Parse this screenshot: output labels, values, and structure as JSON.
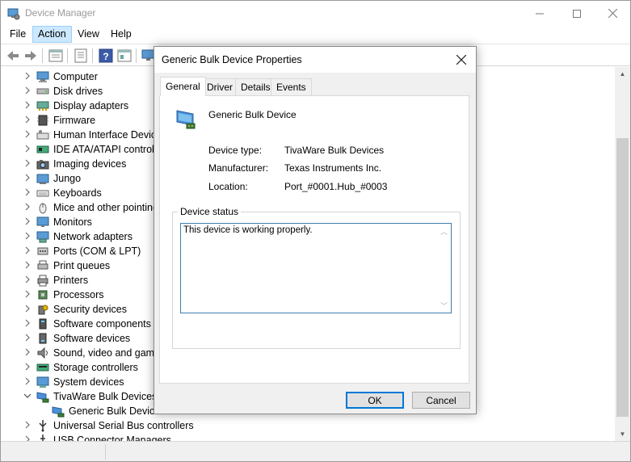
{
  "app": {
    "title": "Device Manager",
    "icon": "device-manager-icon",
    "window_controls": {
      "minimize": "—",
      "maximize": "☐",
      "close": "✕"
    }
  },
  "menu": [
    "File",
    "Action",
    "View",
    "Help"
  ],
  "toolbar_icons": [
    "back-arrow-icon",
    "forward-arrow-icon",
    "properties-grid-icon",
    "show-hide-tree-icon",
    "help-icon",
    "update-driver-icon",
    "monitor-icon"
  ],
  "tree": {
    "items": [
      {
        "label": "Computer",
        "icon": "computer-icon",
        "expanded": false
      },
      {
        "label": "Disk drives",
        "icon": "disk-drive-icon",
        "expanded": false
      },
      {
        "label": "Display adapters",
        "icon": "display-adapter-icon",
        "expanded": false
      },
      {
        "label": "Firmware",
        "icon": "firmware-icon",
        "expanded": false
      },
      {
        "label": "Human Interface Devices",
        "icon": "hid-icon",
        "expanded": false
      },
      {
        "label": "IDE ATA/ATAPI controllers",
        "icon": "ide-controller-icon",
        "expanded": false
      },
      {
        "label": "Imaging devices",
        "icon": "camera-icon",
        "expanded": false
      },
      {
        "label": "Jungo",
        "icon": "jungo-icon",
        "expanded": false
      },
      {
        "label": "Keyboards",
        "icon": "keyboard-icon",
        "expanded": false
      },
      {
        "label": "Mice and other pointing devices",
        "icon": "mouse-icon",
        "expanded": false
      },
      {
        "label": "Monitors",
        "icon": "monitor-icon",
        "expanded": false
      },
      {
        "label": "Network adapters",
        "icon": "network-adapter-icon",
        "expanded": false
      },
      {
        "label": "Ports (COM & LPT)",
        "icon": "port-icon",
        "expanded": false
      },
      {
        "label": "Print queues",
        "icon": "print-queue-icon",
        "expanded": false
      },
      {
        "label": "Printers",
        "icon": "printer-icon",
        "expanded": false
      },
      {
        "label": "Processors",
        "icon": "processor-icon",
        "expanded": false
      },
      {
        "label": "Security devices",
        "icon": "security-device-icon",
        "expanded": false
      },
      {
        "label": "Software components",
        "icon": "software-component-icon",
        "expanded": false
      },
      {
        "label": "Software devices",
        "icon": "software-device-icon",
        "expanded": false
      },
      {
        "label": "Sound, video and game controllers",
        "icon": "speaker-icon",
        "expanded": false
      },
      {
        "label": "Storage controllers",
        "icon": "storage-controller-icon",
        "expanded": false
      },
      {
        "label": "System devices",
        "icon": "system-device-icon",
        "expanded": false
      },
      {
        "label": "TivaWare Bulk Devices",
        "icon": "usb-device-icon",
        "expanded": true
      },
      {
        "label": "Generic Bulk Device",
        "icon": "usb-device-icon",
        "child": true
      },
      {
        "label": "Universal Serial Bus controllers",
        "icon": "usb-controller-icon",
        "expanded": false
      },
      {
        "label": "USB Connector Managers",
        "icon": "usb-connector-icon",
        "expanded": false
      }
    ]
  },
  "dialog": {
    "title": "Generic Bulk Device Properties",
    "close": "✕",
    "tabs": [
      "General",
      "Driver",
      "Details",
      "Events"
    ],
    "active_tab": "General",
    "device_name": "Generic Bulk Device",
    "properties": [
      {
        "label": "Device type:",
        "value": "TivaWare Bulk Devices"
      },
      {
        "label": "Manufacturer:",
        "value": "Texas Instruments Inc."
      },
      {
        "label": "Location:",
        "value": "Port_#0001.Hub_#0003"
      }
    ],
    "status_group_label": "Device status",
    "status_text": "This device is working properly.",
    "ok_label": "OK",
    "cancel_label": "Cancel"
  },
  "colors": {
    "accent": "#0078d7",
    "menu_highlight": "#cce8ff",
    "dialog_bg": "#f0f0f0",
    "title_disabled": "#999999"
  }
}
